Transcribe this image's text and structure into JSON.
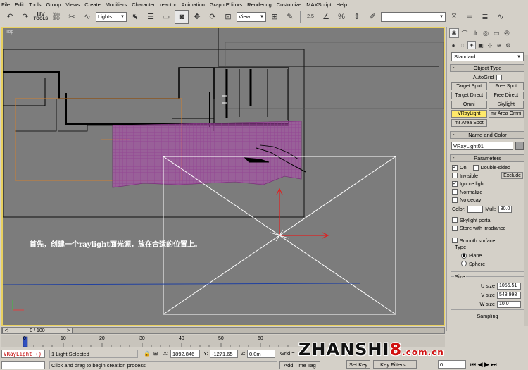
{
  "menu": [
    "File",
    "Edit",
    "Tools",
    "Group",
    "Views",
    "Create",
    "Modifiers",
    "Character",
    "reactor",
    "Animation",
    "Graph Editors",
    "Rendering",
    "Customize",
    "MAXScript",
    "Help"
  ],
  "toolbar": {
    "uv_label": "UV",
    "uv_sub": "TOOLS",
    "selection_filter": "Lights",
    "reference_coord": "View",
    "snap_label": "2.5"
  },
  "viewport": {
    "label": "Top",
    "caption": "首先，创建一个raylight面光源，放在合适的位置上。"
  },
  "panel": {
    "dropdown": "Standard",
    "object_type": {
      "title": "Object Type",
      "autogrid": "AutoGrid",
      "buttons": [
        "Target Spot",
        "Free Spot",
        "Target Direct",
        "Free Direct",
        "Omni",
        "Skylight",
        "VRayLight",
        "mr Area Omni",
        "mr Area Spot"
      ]
    },
    "name_color": {
      "title": "Name and Color",
      "name": "VRayLight01",
      "swatch_color": "#a0a0a0"
    },
    "parameters": {
      "title": "Parameters",
      "on": "On",
      "double_sided": "Double-sided",
      "invisible": "Invisible",
      "exclude": "Exclude",
      "ignore_light": "Ignore light",
      "normalize": "Normalize",
      "no_decay": "No decay",
      "color_label": "Color:",
      "mult_label": "Mult:",
      "mult_value": "30.0",
      "skylight_portal": "Skylight portal",
      "store_irradiance": "Store with irradiance",
      "smooth_surface": "Smooth surface",
      "type_label": "Type",
      "plane": "Plane",
      "sphere": "Sphere",
      "size_label": "Size",
      "u_size_label": "U size",
      "u_size": "1056.51",
      "v_size_label": "V size",
      "v_size": "548.998",
      "w_size_label": "W size",
      "w_size": "10.0",
      "sampling": "Sampling"
    }
  },
  "timeline": {
    "frame": "0 / 100",
    "ticks": [
      "0",
      "10",
      "20",
      "30",
      "40",
      "50",
      "60"
    ]
  },
  "status": {
    "selected_name": "VRayLight ()",
    "selection_info": "1 Light Selected",
    "x_label": "X:",
    "x_value": "1892.846",
    "y_label": "Y:",
    "y_value": "-1271.65",
    "z_label": "Z:",
    "z_value": "0.0m",
    "grid_label": "Grid =",
    "prompt": "Click and drag to begin creation process",
    "add_time_tag": "Add Time Tag",
    "set_key": "Set Key",
    "key_filters": "Key Filters...",
    "frame_field": "0"
  },
  "watermark": {
    "text_a": "ZHANSHI",
    "text_b": "8",
    "text_c": ".com.cn"
  }
}
